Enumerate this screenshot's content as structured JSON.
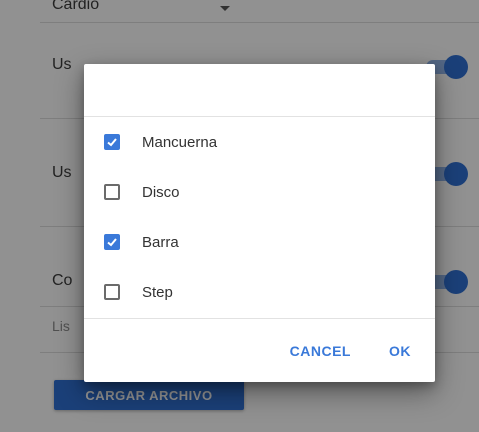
{
  "background": {
    "top_select_text": "Cardio",
    "row1_label": "Us",
    "row2_label": "Us",
    "row3_label": "Co",
    "row4_label": "Lis",
    "load_file_button": "CARGAR ARCHIVO"
  },
  "dialog": {
    "options": [
      {
        "label": "Mancuerna",
        "checked": true
      },
      {
        "label": "Disco",
        "checked": false
      },
      {
        "label": "Barra",
        "checked": true
      },
      {
        "label": "Step",
        "checked": false
      }
    ],
    "cancel_label": "CANCEL",
    "ok_label": "OK"
  },
  "colors": {
    "accent": "#3a79d9",
    "scrim": "rgba(0,0,0,0.42)"
  },
  "icons": {
    "checkbox_checked": "check-icon",
    "dropdown": "chevron-down-icon"
  }
}
